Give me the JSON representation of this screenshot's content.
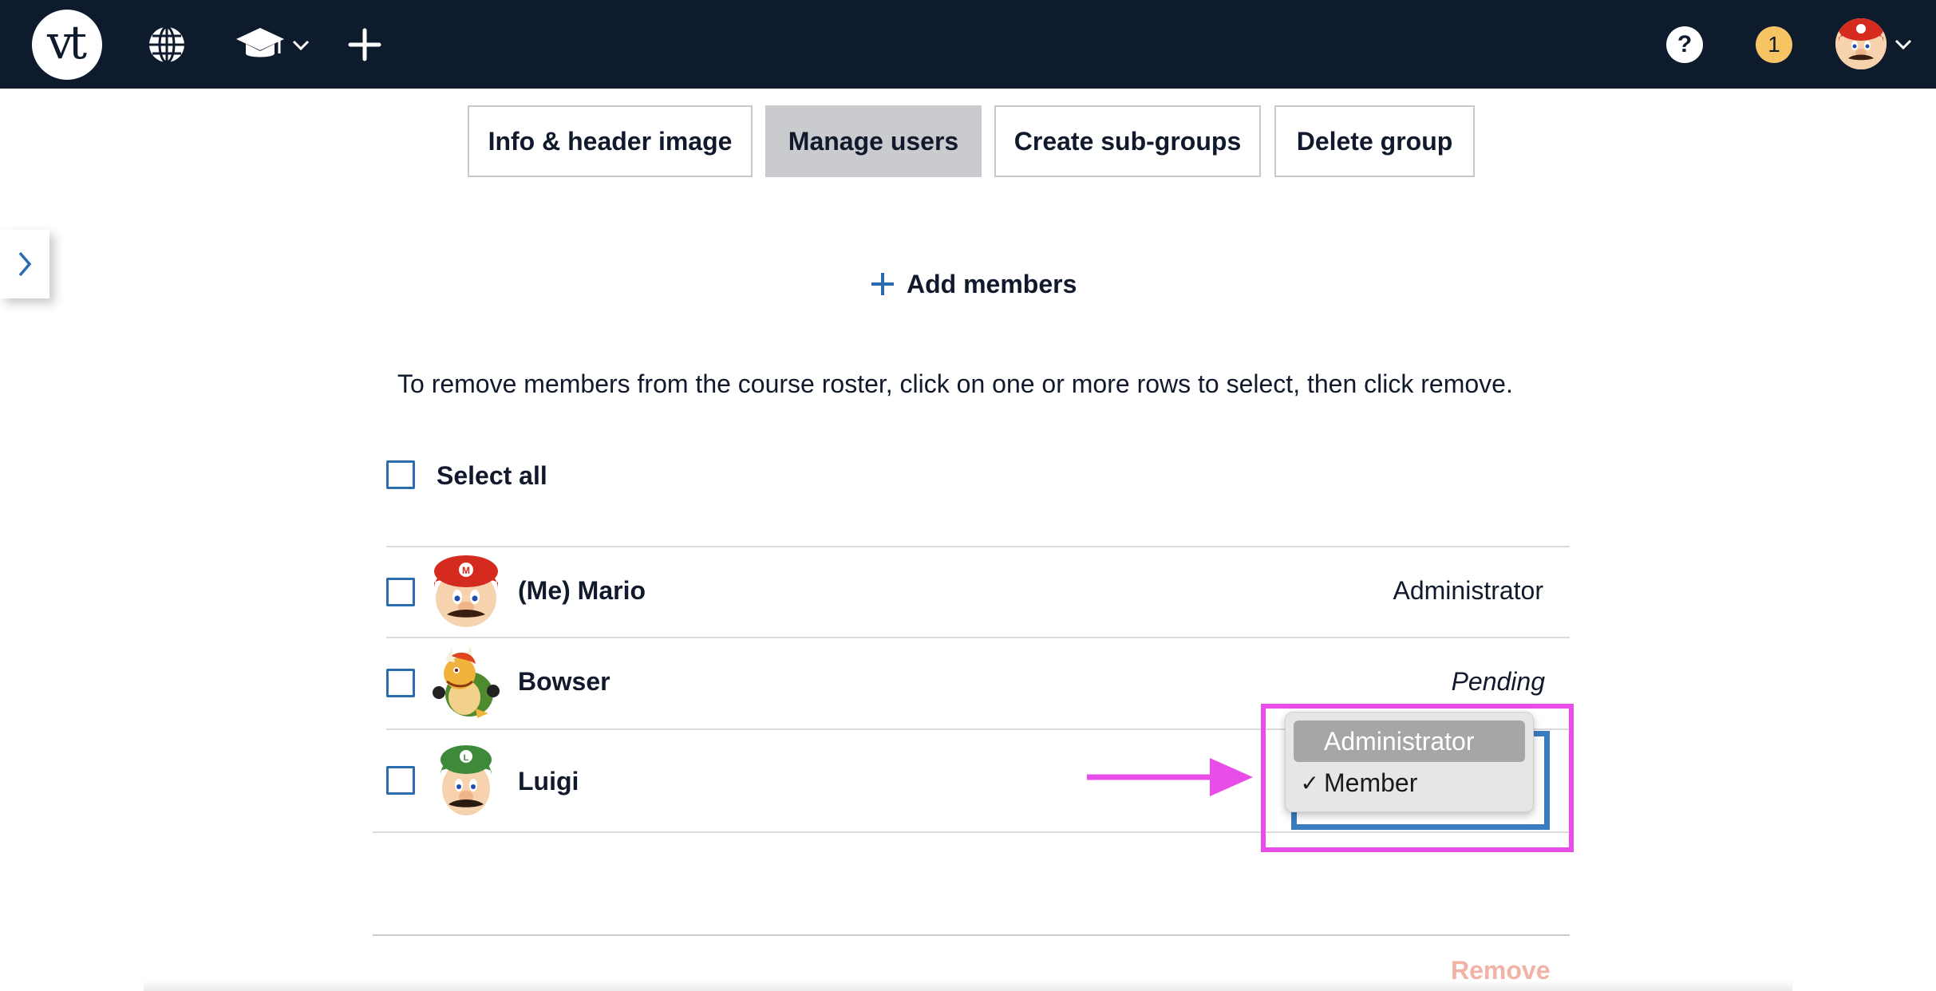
{
  "topbar": {
    "logo_text": "vt",
    "help_label": "?",
    "notification_count": "1",
    "icons": [
      "globe-icon",
      "graduation-cap-icon",
      "chevron-down-icon",
      "plus-icon",
      "help-icon",
      "user-avatar",
      "chevron-down-icon"
    ]
  },
  "tabs": [
    {
      "label": "Info & header image",
      "active": false
    },
    {
      "label": "Manage users",
      "active": true
    },
    {
      "label": "Create sub-groups",
      "active": false
    },
    {
      "label": "Delete group",
      "active": false
    }
  ],
  "add_members": {
    "icon": "plus-icon",
    "label": "Add members"
  },
  "instructions": "To remove members from the course roster, click on one or more rows to select, then click remove.",
  "select_all": {
    "label": "Select all",
    "checked": false
  },
  "members": [
    {
      "name": "(Me) Mario",
      "role": "Administrator",
      "avatar": "mario-avatar",
      "checked": false
    },
    {
      "name": "Bowser",
      "role": "Pending",
      "avatar": "bowser-avatar",
      "checked": false
    },
    {
      "name": "Luigi",
      "role": "Member",
      "avatar": "luigi-avatar",
      "checked": false
    }
  ],
  "role_dropdown": {
    "options": [
      "Administrator",
      "Member"
    ],
    "highlighted": "Administrator",
    "selected": "Member",
    "check_mark": "✓"
  },
  "remove_label": "Remove",
  "colors": {
    "topbar": "#0e1b2d",
    "accent_blue": "#2b6cb0",
    "annotation_magenta": "#e84ee7",
    "badge_yellow": "#f7c463",
    "remove_disabled": "#f0b3a5"
  }
}
